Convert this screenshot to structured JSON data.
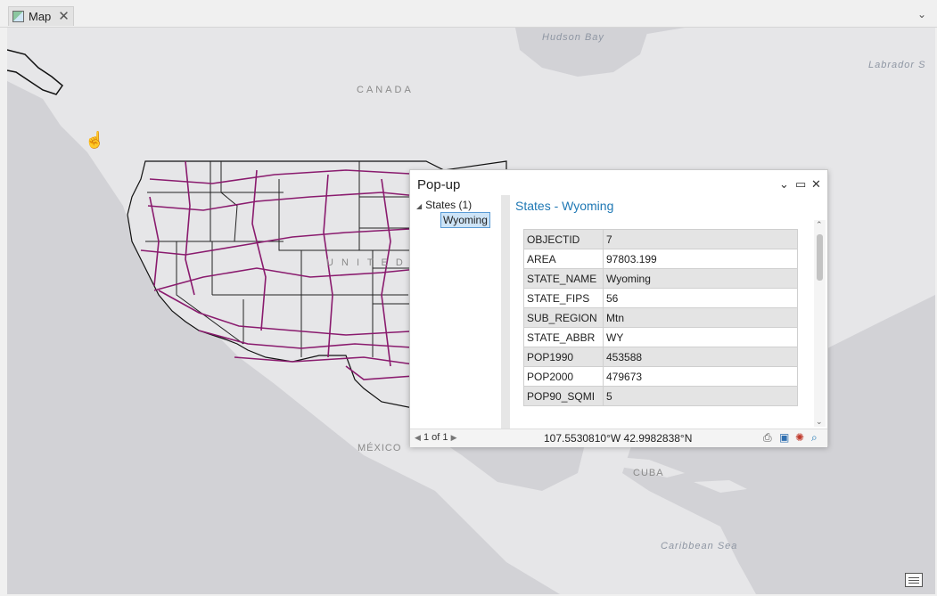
{
  "tab": {
    "label": "Map"
  },
  "map": {
    "labels": {
      "canada": "CANADA",
      "mexico": "MÉXICO",
      "cuba": "CUBA",
      "united": "U N I T E D"
    },
    "water": {
      "hudson": "Hudson Bay",
      "labrador": "Labrador S",
      "caribbean": "Caribbean Sea"
    },
    "colors": {
      "land": "#e6e6e8",
      "water": "#d2d2d6",
      "roads": "#8a1b6e",
      "states": "#1b1b1b"
    }
  },
  "popup": {
    "title": "Pop-up",
    "tree": {
      "layer": "States  (1)",
      "feature": "Wyoming"
    },
    "detail_title": "States - Wyoming",
    "fields": [
      {
        "name": "OBJECTID",
        "value": "7"
      },
      {
        "name": "AREA",
        "value": "97803.199"
      },
      {
        "name": "STATE_NAME",
        "value": "Wyoming"
      },
      {
        "name": "STATE_FIPS",
        "value": "56"
      },
      {
        "name": "SUB_REGION",
        "value": "Mtn"
      },
      {
        "name": "STATE_ABBR",
        "value": "WY"
      },
      {
        "name": "POP1990",
        "value": "453588"
      },
      {
        "name": "POP2000",
        "value": "479673"
      },
      {
        "name": "POP90_SQMI",
        "value": "5"
      }
    ],
    "paging": "1 of 1",
    "coordinates": "107.5530810°W 42.9982838°N"
  }
}
